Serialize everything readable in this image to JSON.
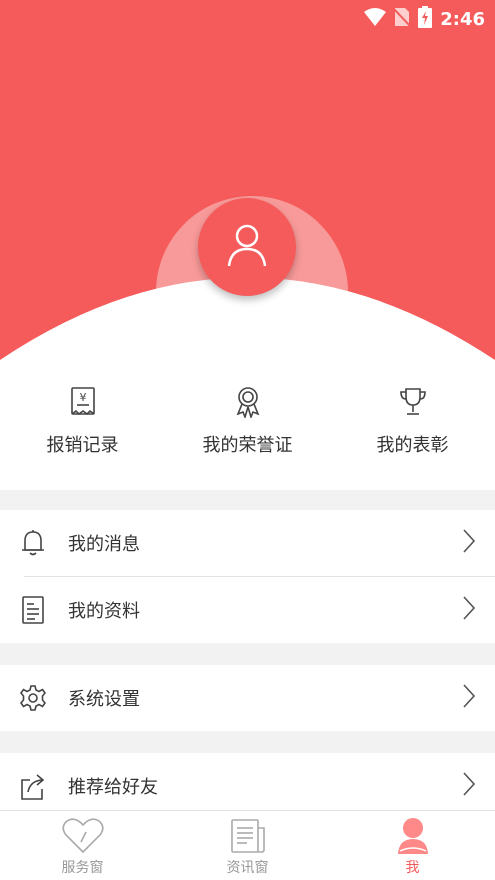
{
  "colors": {
    "accent": "#f55b5b",
    "text": "#333333",
    "muted": "#999999"
  },
  "status_bar": {
    "time": "2:46",
    "icons": [
      "wifi-icon",
      "no-sim-icon",
      "battery-charging-icon"
    ]
  },
  "profile": {
    "avatar_icon": "user-icon"
  },
  "quick_actions": [
    {
      "label": "报销记录",
      "icon": "receipt-icon"
    },
    {
      "label": "我的荣誉证",
      "icon": "medal-icon"
    },
    {
      "label": "我的表彰",
      "icon": "trophy-icon"
    }
  ],
  "menu": {
    "messages": {
      "label": "我的消息",
      "icon": "bell-icon"
    },
    "profile_info": {
      "label": "我的资料",
      "icon": "document-icon"
    },
    "settings": {
      "label": "系统设置",
      "icon": "gear-icon"
    },
    "share": {
      "label": "推荐给好友",
      "icon": "share-icon"
    }
  },
  "bottom_nav": [
    {
      "label": "服务窗",
      "icon": "heart-icon",
      "active": false
    },
    {
      "label": "资讯窗",
      "icon": "news-icon",
      "active": false
    },
    {
      "label": "我",
      "icon": "person-icon",
      "active": true
    }
  ]
}
